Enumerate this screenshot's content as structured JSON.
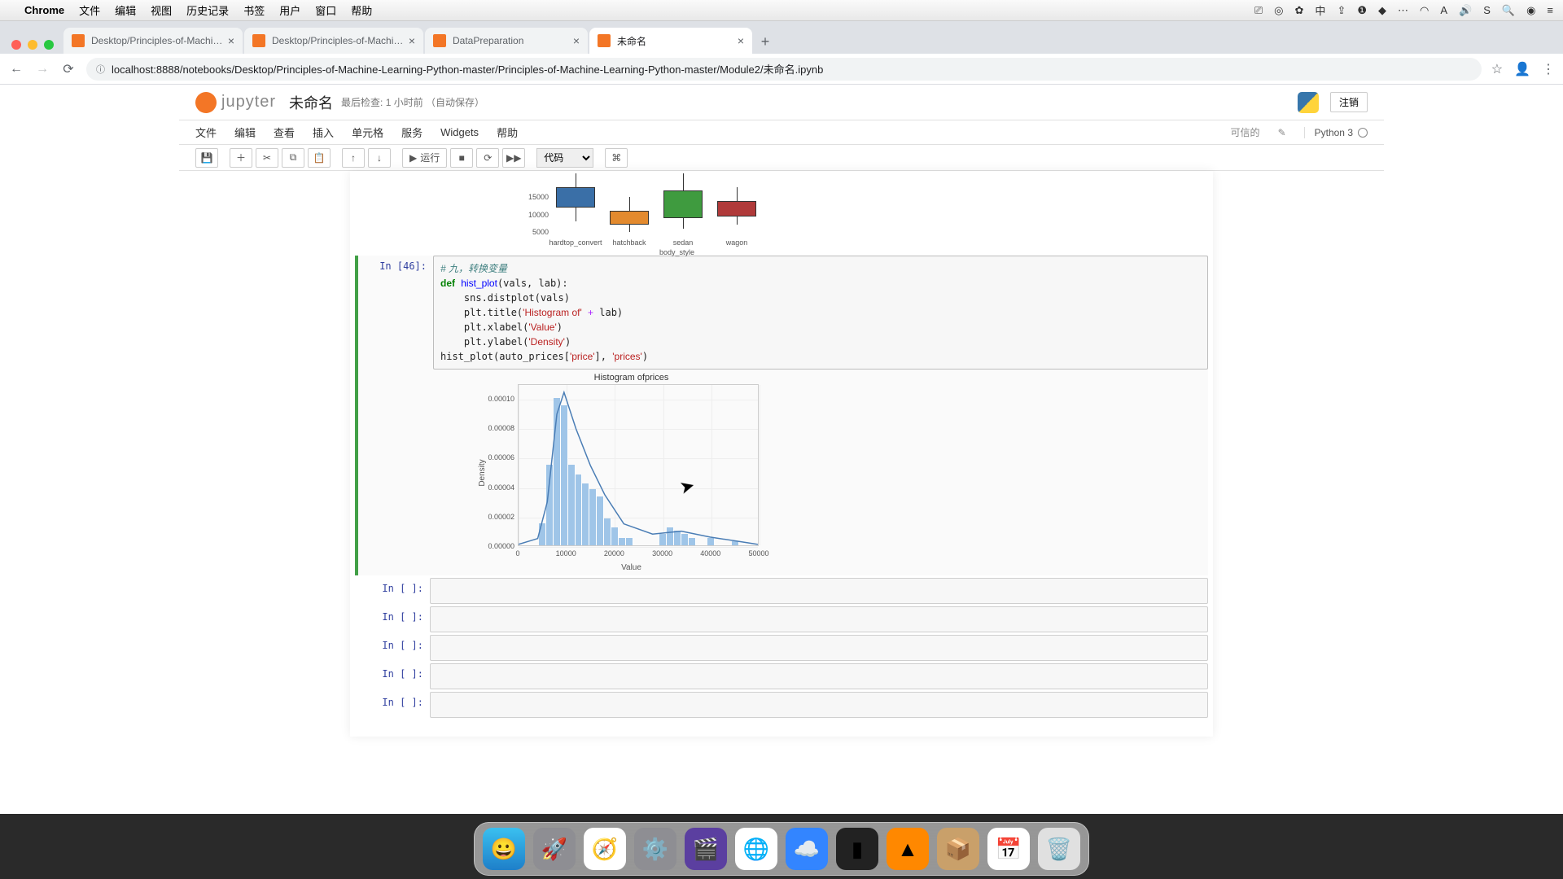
{
  "mac_menu": {
    "app": "Chrome",
    "items": [
      "文件",
      "编辑",
      "视图",
      "历史记录",
      "书签",
      "用户",
      "窗口",
      "帮助"
    ]
  },
  "tabs": [
    {
      "title": "Desktop/Principles-of-Machine",
      "active": false
    },
    {
      "title": "Desktop/Principles-of-Machine",
      "active": false
    },
    {
      "title": "DataPreparation",
      "active": false
    },
    {
      "title": "未命名",
      "active": true
    }
  ],
  "url": "localhost:8888/notebooks/Desktop/Principles-of-Machine-Learning-Python-master/Principles-of-Machine-Learning-Python-master/Module2/未命名.ipynb",
  "jupyter": {
    "title": "未命名",
    "checkpoint": "最后检查: 1 小时前 （自动保存）",
    "logout": "注销",
    "menus": [
      "文件",
      "编辑",
      "查看",
      "插入",
      "单元格",
      "服务",
      "Widgets",
      "帮助"
    ],
    "trusted": "可信的",
    "kernel": "Python 3",
    "celltype": "代码",
    "run_label": "运行"
  },
  "code": {
    "prompt": "In [46]:",
    "lines": [
      {
        "t": "comment",
        "s": "# 九，转换变量"
      },
      {
        "t": "def",
        "s": "def hist_plot(vals, lab):"
      },
      {
        "t": "body",
        "s": "    sns.distplot(vals)"
      },
      {
        "t": "body2",
        "s": "    plt.title('Histogram of' + lab)"
      },
      {
        "t": "body3",
        "s": "    plt.xlabel('Value')"
      },
      {
        "t": "body4",
        "s": "    plt.ylabel('Density')"
      },
      {
        "t": "call",
        "s": "hist_plot(auto_prices['price'], 'prices')"
      }
    ]
  },
  "empty_prompt": "In [ ]:",
  "chart_data": [
    {
      "type": "box",
      "title": "",
      "xlabel": "body_style",
      "categories": [
        "hardtop_convert",
        "hatchback",
        "sedan",
        "wagon"
      ],
      "series": [
        {
          "name": "price",
          "boxes": [
            {
              "low": 8000,
              "q1": 12000,
              "med": 15000,
              "q3": 18000,
              "high": 22000,
              "color": "#3a6fa7"
            },
            {
              "low": 5000,
              "q1": 7000,
              "med": 8500,
              "q3": 11000,
              "high": 15000,
              "color": "#e38a2e"
            },
            {
              "low": 6000,
              "q1": 9000,
              "med": 12000,
              "q3": 17000,
              "high": 22000,
              "color": "#3f9b3f"
            },
            {
              "low": 7000,
              "q1": 9500,
              "med": 11500,
              "q3": 14000,
              "high": 18000,
              "color": "#b03a3a"
            }
          ]
        }
      ],
      "yticks": [
        5000,
        10000,
        15000
      ]
    },
    {
      "type": "bar",
      "title": "Histogram ofprices",
      "xlabel": "Value",
      "ylabel": "Density",
      "xlim": [
        0,
        50000
      ],
      "ylim": [
        0,
        0.00011
      ],
      "xticks": [
        0,
        10000,
        20000,
        30000,
        40000,
        50000
      ],
      "yticks": [
        0.0,
        2e-05,
        4e-05,
        6e-05,
        8e-05,
        0.0001
      ],
      "bins": [
        {
          "x": 5000,
          "h": 1.5e-05
        },
        {
          "x": 6500,
          "h": 5.5e-05
        },
        {
          "x": 8000,
          "h": 0.0001
        },
        {
          "x": 9500,
          "h": 9.5e-05
        },
        {
          "x": 11000,
          "h": 5.5e-05
        },
        {
          "x": 12500,
          "h": 4.8e-05
        },
        {
          "x": 14000,
          "h": 4.2e-05
        },
        {
          "x": 15500,
          "h": 3.8e-05
        },
        {
          "x": 17000,
          "h": 3.3e-05
        },
        {
          "x": 18500,
          "h": 1.8e-05
        },
        {
          "x": 20000,
          "h": 1.2e-05
        },
        {
          "x": 21500,
          "h": 5e-06
        },
        {
          "x": 23000,
          "h": 5e-06
        },
        {
          "x": 30000,
          "h": 8e-06
        },
        {
          "x": 31500,
          "h": 1.2e-05
        },
        {
          "x": 33000,
          "h": 1e-05
        },
        {
          "x": 34500,
          "h": 8e-06
        },
        {
          "x": 36000,
          "h": 5e-06
        },
        {
          "x": 40000,
          "h": 5e-06
        },
        {
          "x": 45000,
          "h": 3e-06
        }
      ],
      "kde": [
        [
          0,
          1e-06
        ],
        [
          4000,
          5e-06
        ],
        [
          6000,
          3e-05
        ],
        [
          8000,
          9e-05
        ],
        [
          9500,
          0.000105
        ],
        [
          12000,
          8e-05
        ],
        [
          15000,
          5.5e-05
        ],
        [
          18000,
          3.5e-05
        ],
        [
          22000,
          1.5e-05
        ],
        [
          28000,
          8e-06
        ],
        [
          34000,
          1e-05
        ],
        [
          40000,
          6e-06
        ],
        [
          48000,
          2e-06
        ],
        [
          50000,
          1e-06
        ]
      ]
    }
  ]
}
